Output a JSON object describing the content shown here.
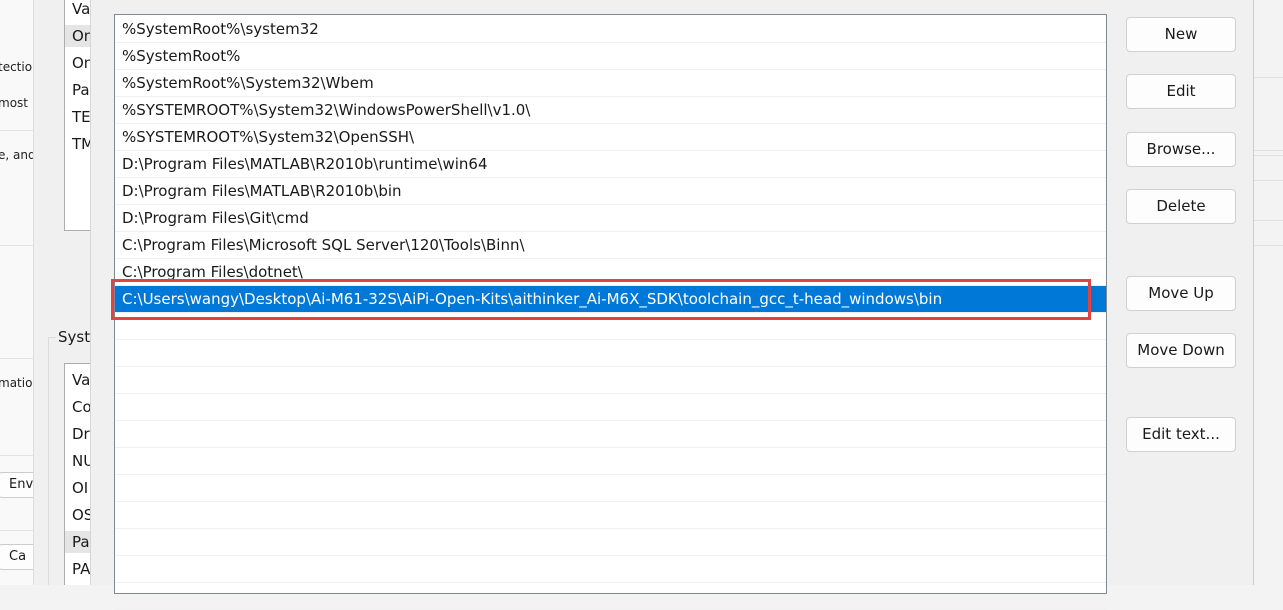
{
  "background_window": {
    "fragments": [
      "tection",
      "most",
      "e, and",
      "matio"
    ],
    "buttons": [
      "Env",
      "Ca"
    ]
  },
  "middle_window": {
    "user_vars_items": [
      "Va",
      "On",
      "On",
      "Pa",
      "TE",
      "TM"
    ],
    "system_group_label": "Syste",
    "system_vars_items": [
      "Va",
      "Co",
      "Dr",
      "NU",
      "OI",
      "OS",
      "Pa",
      "PA"
    ]
  },
  "path_editor": {
    "entries": [
      "%SystemRoot%\\system32",
      "%SystemRoot%",
      "%SystemRoot%\\System32\\Wbem",
      "%SYSTEMROOT%\\System32\\WindowsPowerShell\\v1.0\\",
      "%SYSTEMROOT%\\System32\\OpenSSH\\",
      "D:\\Program Files\\MATLAB\\R2010b\\runtime\\win64",
      "D:\\Program Files\\MATLAB\\R2010b\\bin",
      "D:\\Program Files\\Git\\cmd",
      "C:\\Program Files\\Microsoft SQL Server\\120\\Tools\\Binn\\",
      "C:\\Program Files\\dotnet\\",
      "C:\\Users\\wangy\\Desktop\\Ai-M61-32S\\AiPi-Open-Kits\\aithinker_Ai-M6X_SDK\\toolchain_gcc_t-head_windows\\bin"
    ],
    "selected_index": 10,
    "buttons": {
      "new": "New",
      "edit": "Edit",
      "browse": "Browse...",
      "delete": "Delete",
      "move_up": "Move Up",
      "move_down": "Move Down",
      "edit_text": "Edit text..."
    },
    "colors": {
      "selection": "#0078d7",
      "highlight_box": "#e04343"
    }
  }
}
